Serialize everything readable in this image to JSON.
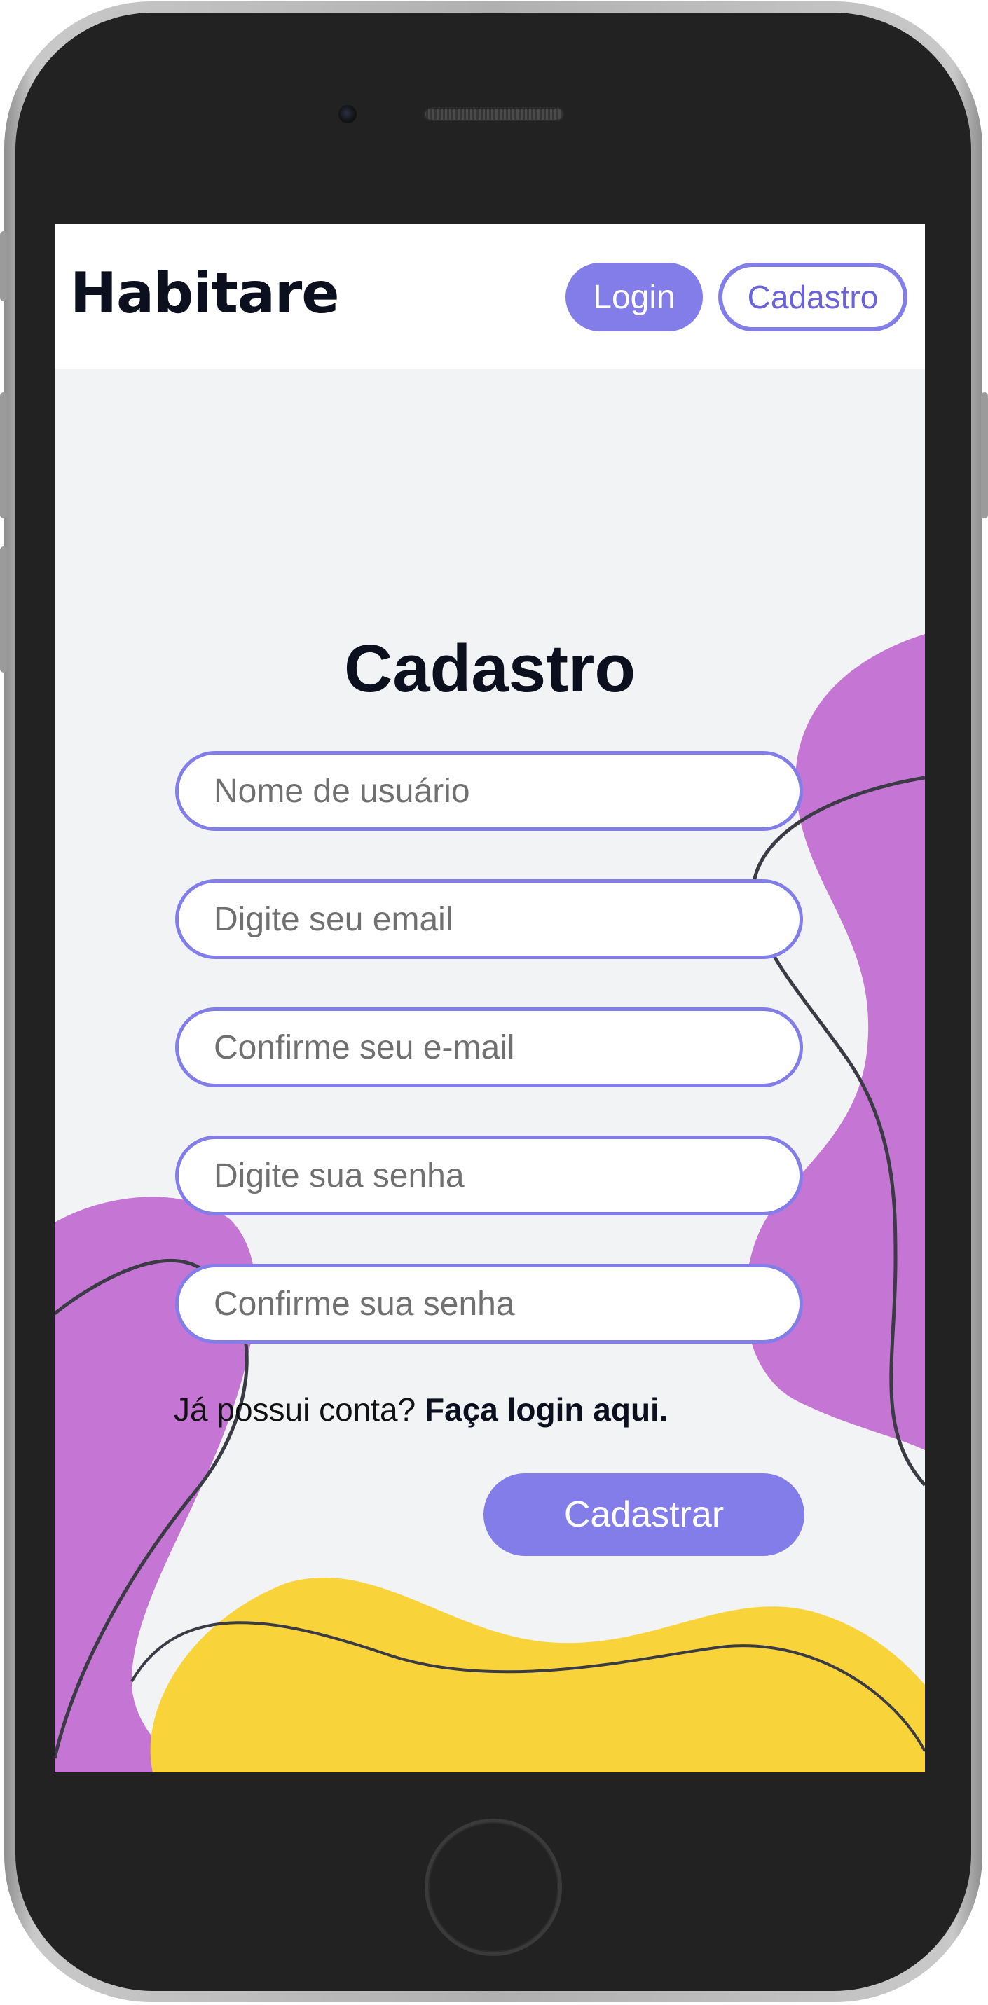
{
  "brand": {
    "logo": "Habitare"
  },
  "nav": {
    "login_label": "Login",
    "cadastro_label": "Cadastro"
  },
  "form": {
    "title": "Cadastro",
    "fields": [
      {
        "placeholder": "Nome de usuário"
      },
      {
        "placeholder": "Digite seu email"
      },
      {
        "placeholder": "Confirme seu e-mail"
      },
      {
        "placeholder": "Digite sua senha"
      },
      {
        "placeholder": "Confirme sua senha"
      }
    ],
    "login_prompt": "Já possui conta?",
    "login_link": "Faça login aqui.",
    "submit_label": "Cadastrar"
  },
  "colors": {
    "accent": "#837dea",
    "blob_purple": "#c576d4",
    "blob_yellow": "#f8d33a",
    "background": "#f2f3f5",
    "text_dark": "#0b0f1e"
  }
}
